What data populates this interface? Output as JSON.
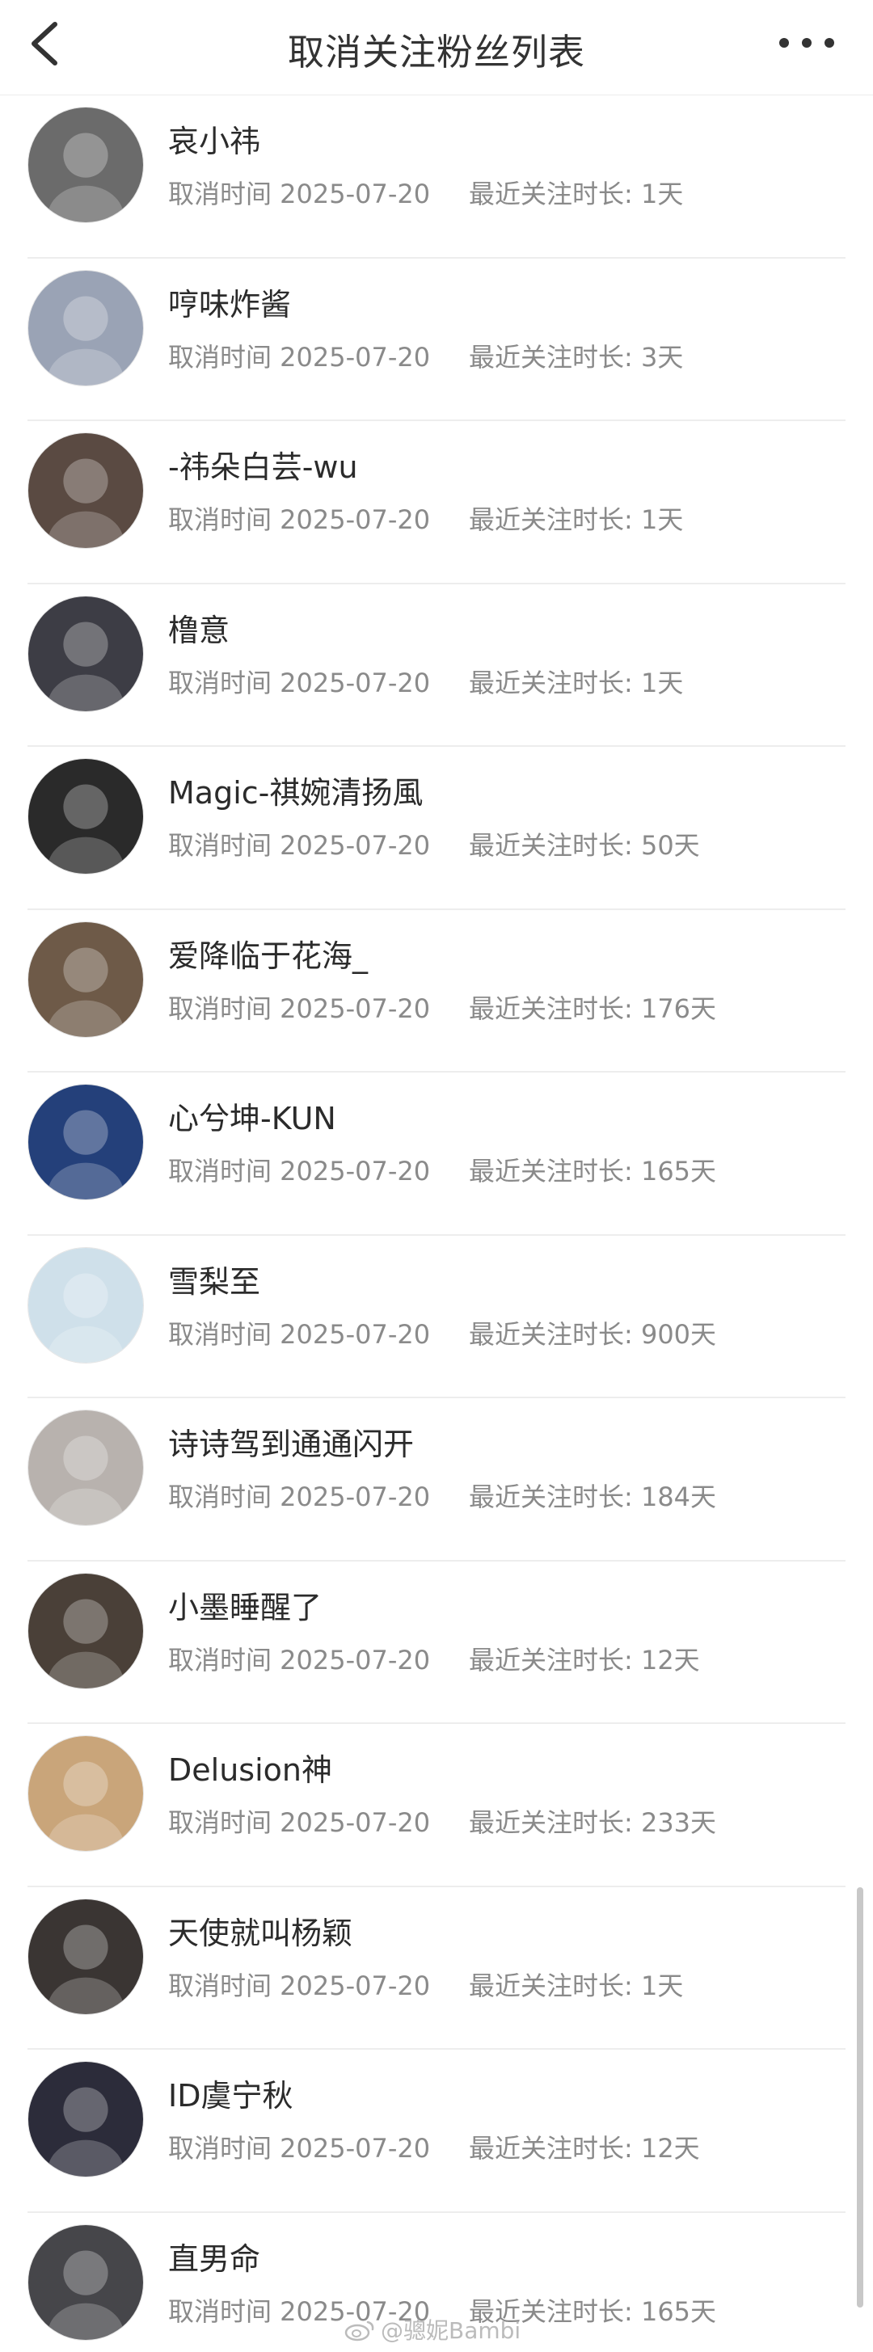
{
  "header": {
    "title": "取消关注粉丝列表"
  },
  "colors": {
    "text_primary": "#2b2b2b",
    "text_secondary": "#8a8a8a",
    "divider": "#ededed"
  },
  "fans": [
    {
      "name": "哀小祎",
      "cancel_time": "取消时间 2025-07-20",
      "duration": "最近关注时长: 1天",
      "avatar_color": "#6b6b6b"
    },
    {
      "name": "哼味炸酱",
      "cancel_time": "取消时间 2025-07-20",
      "duration": "最近关注时长: 3天",
      "avatar_color": "#9aa3b5"
    },
    {
      "name": "-祎朵白芸-wu",
      "cancel_time": "取消时间 2025-07-20",
      "duration": "最近关注时长: 1天",
      "avatar_color": "#5a4a42"
    },
    {
      "name": "橹意",
      "cancel_time": "取消时间 2025-07-20",
      "duration": "最近关注时长: 1天",
      "avatar_color": "#3d3d45"
    },
    {
      "name": "Magic-祺婉清扬風",
      "cancel_time": "取消时间 2025-07-20",
      "duration": "最近关注时长: 50天",
      "avatar_color": "#2a2a2a"
    },
    {
      "name": "爱降临于花海_",
      "cancel_time": "取消时间 2025-07-20",
      "duration": "最近关注时长: 176天",
      "avatar_color": "#6e5a48"
    },
    {
      "name": "心兮坤-KUN",
      "cancel_time": "取消时间 2025-07-20",
      "duration": "最近关注时长: 165天",
      "avatar_color": "#24407a"
    },
    {
      "name": "雪梨至",
      "cancel_time": "取消时间 2025-07-20",
      "duration": "最近关注时长: 900天",
      "avatar_color": "#cfe0ea"
    },
    {
      "name": "诗诗驾到通通闪开",
      "cancel_time": "取消时间 2025-07-20",
      "duration": "最近关注时长: 184天",
      "avatar_color": "#b8b2ae"
    },
    {
      "name": "小墨睡醒了",
      "cancel_time": "取消时间 2025-07-20",
      "duration": "最近关注时长: 12天",
      "avatar_color": "#4a4038"
    },
    {
      "name": "Delusion神",
      "cancel_time": "取消时间 2025-07-20",
      "duration": "最近关注时长: 233天",
      "avatar_color": "#c9a57a"
    },
    {
      "name": "天使就叫杨颖",
      "cancel_time": "取消时间 2025-07-20",
      "duration": "最近关注时长: 1天",
      "avatar_color": "#3a3533"
    },
    {
      "name": "ID虞宁秋",
      "cancel_time": "取消时间 2025-07-20",
      "duration": "最近关注时长: 12天",
      "avatar_color": "#2c2c3a"
    },
    {
      "name": "直男命",
      "cancel_time": "取消时间 2025-07-20",
      "duration": "最近关注时长: 165天",
      "avatar_color": "#46464a"
    }
  ],
  "watermark": {
    "text": "@骢妮Bambi"
  }
}
